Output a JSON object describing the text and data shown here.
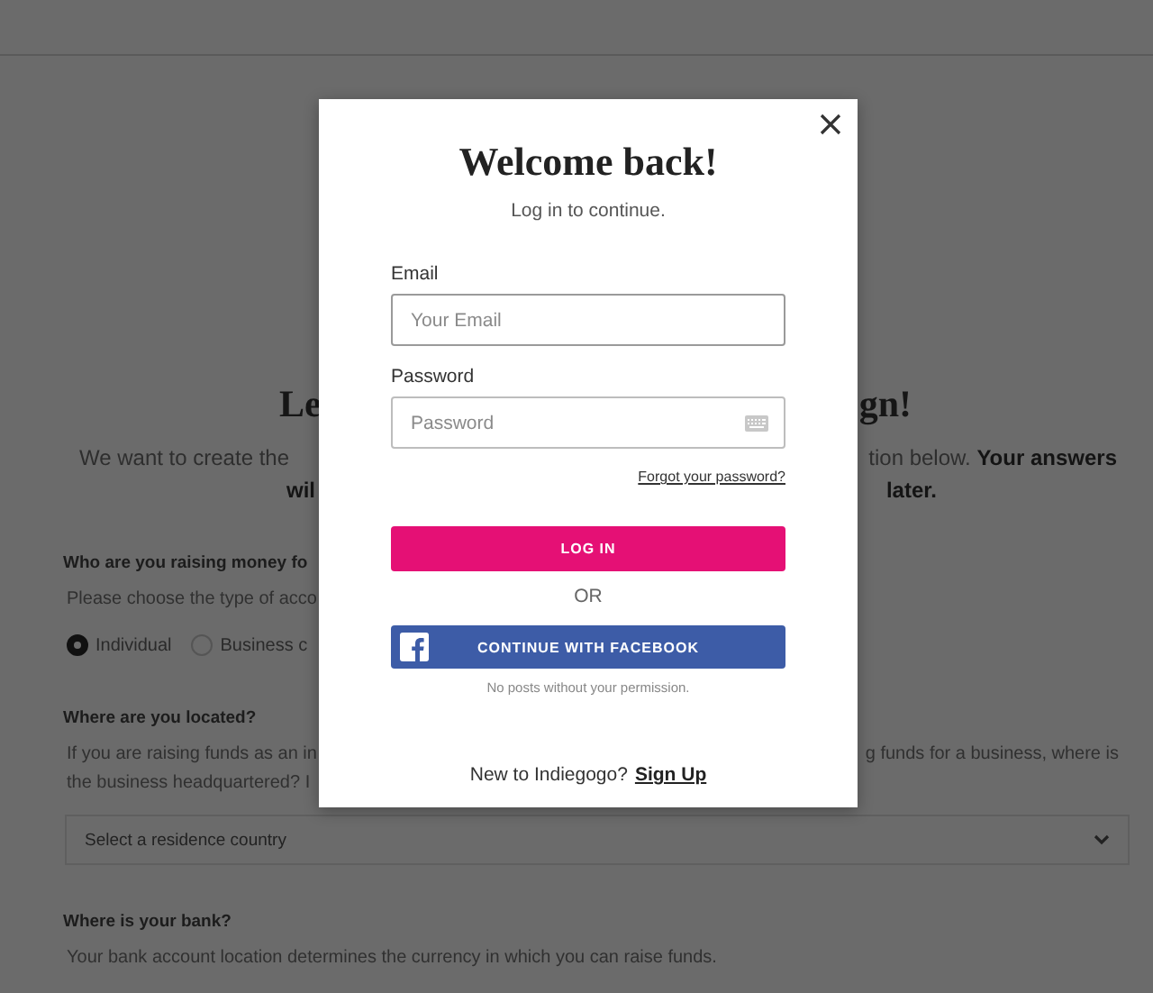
{
  "page": {
    "heading": {
      "left": "Le",
      "right": "gn!"
    },
    "intro_lines": [
      {
        "left": {
          "text": "We want to create the",
          "bold": false
        },
        "right": {
          "text": "tion below. **Your answers**",
          "bold": false
        }
      },
      {
        "left": {
          "text": "wil",
          "bold": true
        },
        "right": {
          "text": "later.",
          "bold": true
        }
      }
    ],
    "sections": [
      {
        "heading": "Who are you raising money fo",
        "lines": [
          {
            "left": "Please choose the type of acco"
          }
        ],
        "radios": [
          {
            "label": "Individual",
            "selected": true
          },
          {
            "label": "Business c",
            "selected": false
          }
        ]
      },
      {
        "heading": "Where are you located?",
        "lines": [
          {
            "left": "If you are raising funds as an in",
            "right": "g funds for a business, where is"
          },
          {
            "left": "the business headquartered? I"
          }
        ],
        "select": {
          "value": "Select a residence country"
        }
      },
      {
        "heading": "Where is your bank?",
        "lines": [
          {
            "left": "Your bank account location determines the currency in which you can raise funds."
          }
        ]
      }
    ]
  },
  "modal": {
    "title": "Welcome back!",
    "subtitle": "Log in to continue.",
    "fields": [
      {
        "kind": "email",
        "label": "Email",
        "placeholder": "Your Email"
      },
      {
        "kind": "password",
        "label": "Password",
        "placeholder": "Password"
      }
    ],
    "forgot_link": "Forgot your password?",
    "login_button": "LOG IN",
    "divider": "OR",
    "facebook_button": "CONTINUE WITH FACEBOOK",
    "note": "No posts without your permission.",
    "footer_text": "New to Indiegogo?",
    "signup_link": "Sign Up"
  }
}
